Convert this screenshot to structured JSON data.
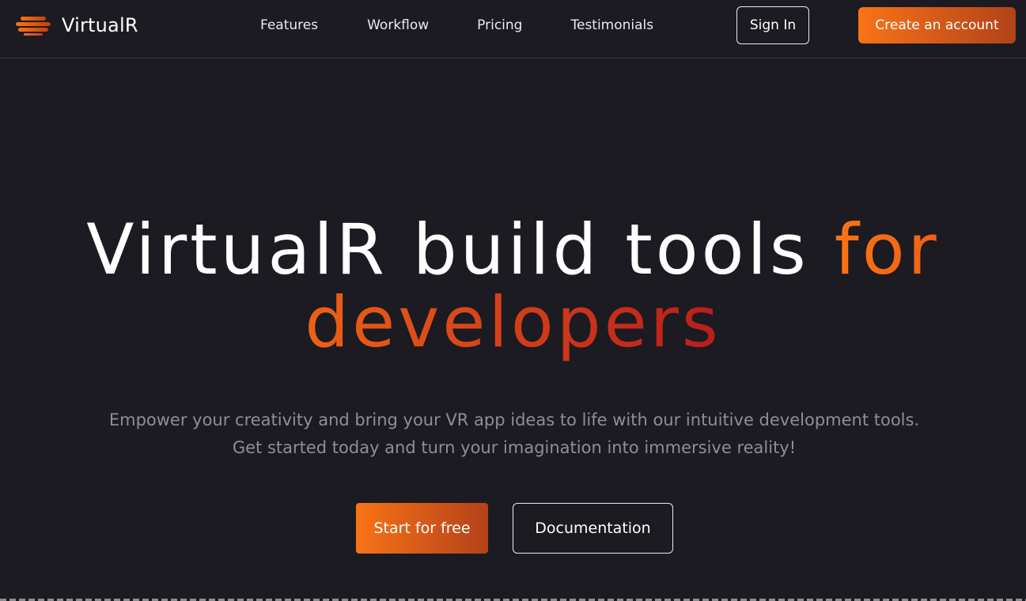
{
  "brand": {
    "name": "VirtualR",
    "logo_icon": "stacked-bars-logo-icon",
    "accent_start": "#f97316",
    "accent_end": "#b91c1c"
  },
  "nav": {
    "links": [
      {
        "label": "Features"
      },
      {
        "label": "Workflow"
      },
      {
        "label": "Pricing"
      },
      {
        "label": "Testimonials"
      }
    ],
    "sign_in_label": "Sign In",
    "create_account_label": "Create an account"
  },
  "hero": {
    "title_main": "VirtualR build tools ",
    "title_accent": "for developers",
    "subtitle_line1": "Empower your creativity and bring your VR app ideas to life with our intuitive development tools.",
    "subtitle_line2": "Get started today and turn your imagination into immersive reality!",
    "primary_cta": "Start for free",
    "secondary_cta": "Documentation"
  },
  "colors": {
    "background": "#1c1b21",
    "muted_text": "#8f8e95"
  }
}
